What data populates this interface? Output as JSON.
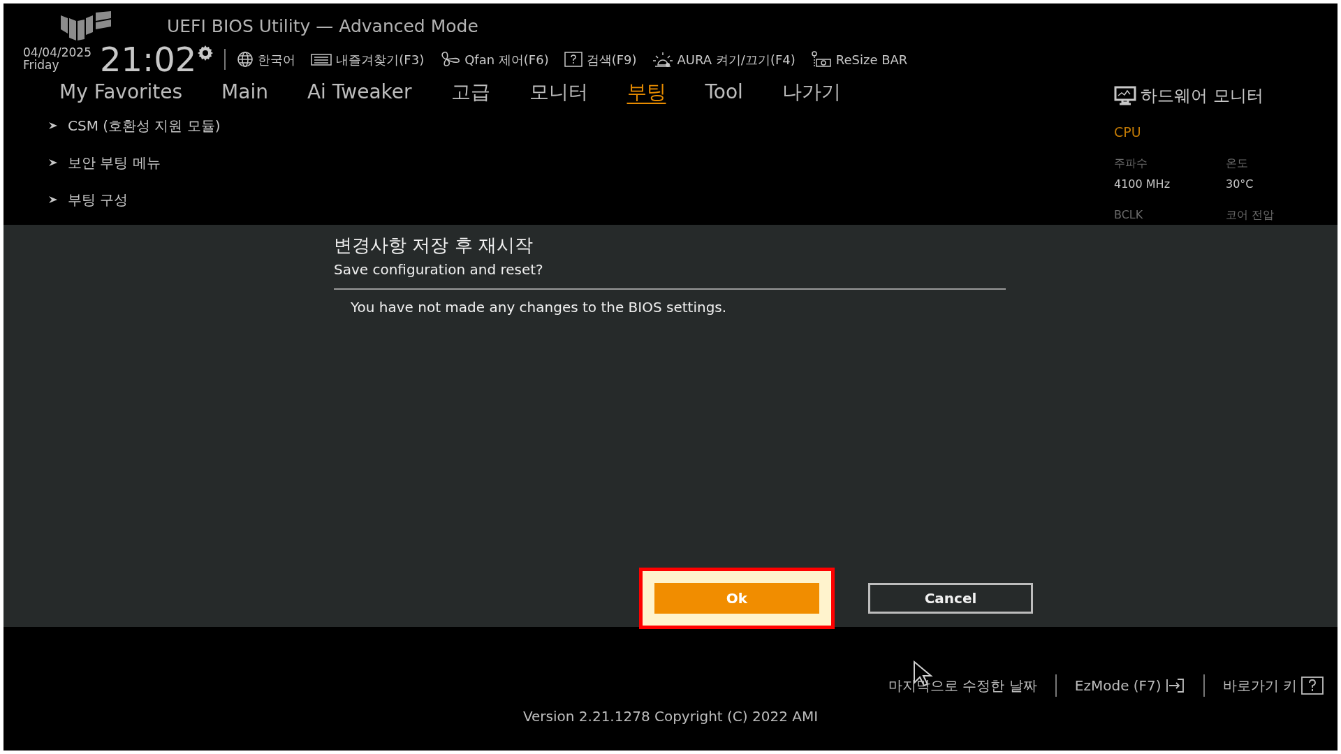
{
  "header": {
    "title": "UEFI BIOS Utility — Advanced Mode",
    "date": "04/04/2025",
    "day": "Friday",
    "time": "21:02"
  },
  "toolbar": [
    {
      "kind": "globe",
      "label": "한국어"
    },
    {
      "kind": "favorites",
      "label": "내즐겨찾기(F3)"
    },
    {
      "kind": "fan",
      "label": "Qfan 제어(F6)"
    },
    {
      "kind": "help",
      "label": "검색(F9)"
    },
    {
      "kind": "aura",
      "label": "AURA 켜기/끄기(F4)"
    },
    {
      "kind": "card",
      "label": "ReSize BAR"
    }
  ],
  "tabs": [
    {
      "label": "My Favorites",
      "selected": false
    },
    {
      "label": "Main",
      "selected": false
    },
    {
      "label": "Ai Tweaker",
      "selected": false
    },
    {
      "label": "고급",
      "selected": false
    },
    {
      "label": "모니터",
      "selected": false
    },
    {
      "label": "부팅",
      "selected": true
    },
    {
      "label": "Tool",
      "selected": false
    },
    {
      "label": "나가기",
      "selected": false
    }
  ],
  "menu": [
    {
      "label": "CSM (호환성 지원 모듈)"
    },
    {
      "label": "보안 부팅 메뉴"
    },
    {
      "label": "부팅 구성"
    }
  ],
  "hardware_monitor": {
    "title": "하드웨어 모니터",
    "section": "CPU",
    "fields": [
      {
        "label": "주파수",
        "value": "4100 MHz"
      },
      {
        "label": "온도",
        "value": "30°C"
      },
      {
        "label": "BCLK"
      },
      {
        "label": "코어 전압"
      }
    ]
  },
  "dialog": {
    "title": "변경사항 저장 후 재시작",
    "subtitle": "Save configuration and reset?",
    "message": "You have not made any changes to the BIOS settings.",
    "buttons": [
      {
        "label": "Ok",
        "selected": true,
        "highlighted": true
      },
      {
        "label": "Cancel",
        "selected": false,
        "highlighted": false
      }
    ]
  },
  "footer": {
    "links": [
      {
        "kind": "text",
        "label": "마지막으로 수정한 날짜"
      },
      {
        "kind": "exit",
        "label": "EzMode (F7)"
      },
      {
        "kind": "help",
        "label": "바로가기 키"
      }
    ],
    "version": "Version 2.21.1278 Copyright (C) 2022 AMI"
  }
}
